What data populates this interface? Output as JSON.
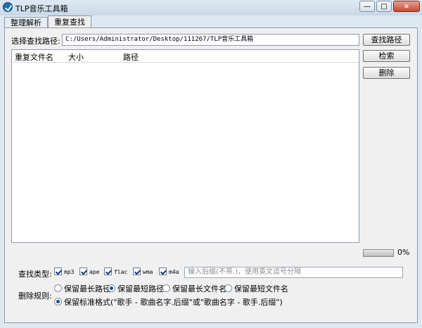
{
  "window": {
    "title": "TLP音乐工具箱",
    "buttons": [
      "minimize",
      "maximize",
      "close"
    ]
  },
  "tabs": [
    {
      "label": "整理解析",
      "active": false
    },
    {
      "label": "重复查找",
      "active": true
    }
  ],
  "search": {
    "path_label": "选择查找路径:",
    "path_value": "C:/Users/Administrator/Desktop/111267/TLP音乐工具箱",
    "search_button": "查找路径",
    "retrieve_button": "检索",
    "delete_button": "删除"
  },
  "table": {
    "columns": [
      "重复文件名",
      "大小",
      "路径"
    ],
    "rows": []
  },
  "progress": {
    "value": 0,
    "text": "0%"
  },
  "filetypes": {
    "label": "查找类型:",
    "options": [
      {
        "label": "mp3",
        "checked": true
      },
      {
        "label": "ape",
        "checked": true
      },
      {
        "label": "flac",
        "checked": true
      },
      {
        "label": "wma",
        "checked": true
      },
      {
        "label": "m4a",
        "checked": true
      }
    ],
    "suffix_placeholder": "输入后缀(不带.)，使用英文逗号分隔"
  },
  "delete_rules": {
    "label": "删除规则:",
    "options": [
      {
        "label": "保留最长路径",
        "selected": false
      },
      {
        "label": "保留最短路径",
        "selected": true
      },
      {
        "label": "保留最长文件名",
        "selected": false
      },
      {
        "label": "保留最短文件名",
        "selected": false
      },
      {
        "label": "保留标准格式(\"歌手 - 歌曲名字.后缀\"或\"歌曲名字 - 歌手.后缀\")",
        "selected": true
      }
    ]
  },
  "icons": [
    "app-icon",
    "minimize-icon",
    "maximize-icon",
    "close-icon"
  ],
  "colors": {
    "title_bar": "#c9d8e8",
    "panel": "#f0f0f0",
    "accent": "#1f6fb8"
  }
}
